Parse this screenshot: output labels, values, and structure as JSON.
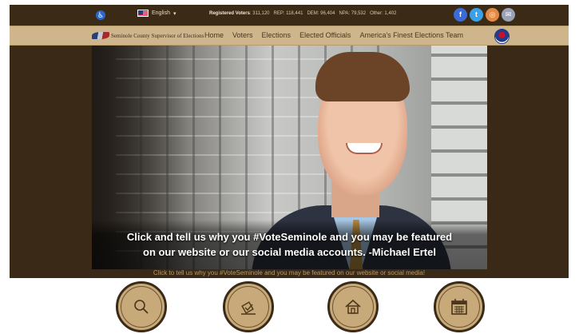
{
  "topbar": {
    "language": "English",
    "stats": {
      "registered_label": "Registered Voters",
      "registered_value": "311,120",
      "rep": "REP: 118,441",
      "dem": "DEM: 96,404",
      "npa": "NPA: 79,532",
      "other": "Other: 1,402"
    },
    "social": [
      "f",
      "t",
      "◎",
      "✉"
    ]
  },
  "logo": {
    "text": "Seminole County Supervisor of Elections"
  },
  "nav": {
    "items": [
      "Home",
      "Voters",
      "Elections",
      "Elected Officials",
      "America's Finest Elections Team"
    ]
  },
  "hero": {
    "caption_line1": "Click and tell us why you #VoteSeminole and you may be featured",
    "caption_line2": "on our website or our social media accounts. -Michael Ertel",
    "subcaption": "Click to tell us why you #VoteSeminole and you may be featured on our website or social media!"
  },
  "quick_links": [
    "search-icon",
    "ballot-icon",
    "home-icon",
    "calendar-icon"
  ],
  "colors": {
    "brown": "#3b2b16",
    "tan": "#cfb58c",
    "gold": "#c8a97a"
  }
}
